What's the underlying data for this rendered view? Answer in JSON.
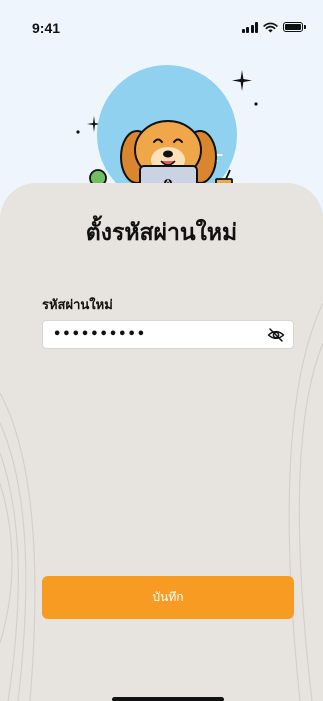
{
  "status_bar": {
    "time": "9:41",
    "signal_icon": "cellular-signal-icon",
    "wifi_icon": "wifi-icon",
    "battery_icon": "battery-icon"
  },
  "illustration": {
    "subject": "dog-with-laptop-illustration",
    "colors": {
      "circle": "#8fd1ef",
      "dog": "#f0a74a",
      "laptop": "#c9d3e4",
      "desk": "#b77a4f"
    }
  },
  "form": {
    "title": "ตั้งรหัสผ่านใหม่",
    "password_label": "รหัสผ่านใหม่",
    "password_value": "••••••••••",
    "visibility_icon": "eye-off-icon",
    "save_label": "บันทึก"
  },
  "colors": {
    "background": "#eef5fd",
    "card": "#e7e3de",
    "accent": "#f89b22",
    "text": "#111111"
  }
}
